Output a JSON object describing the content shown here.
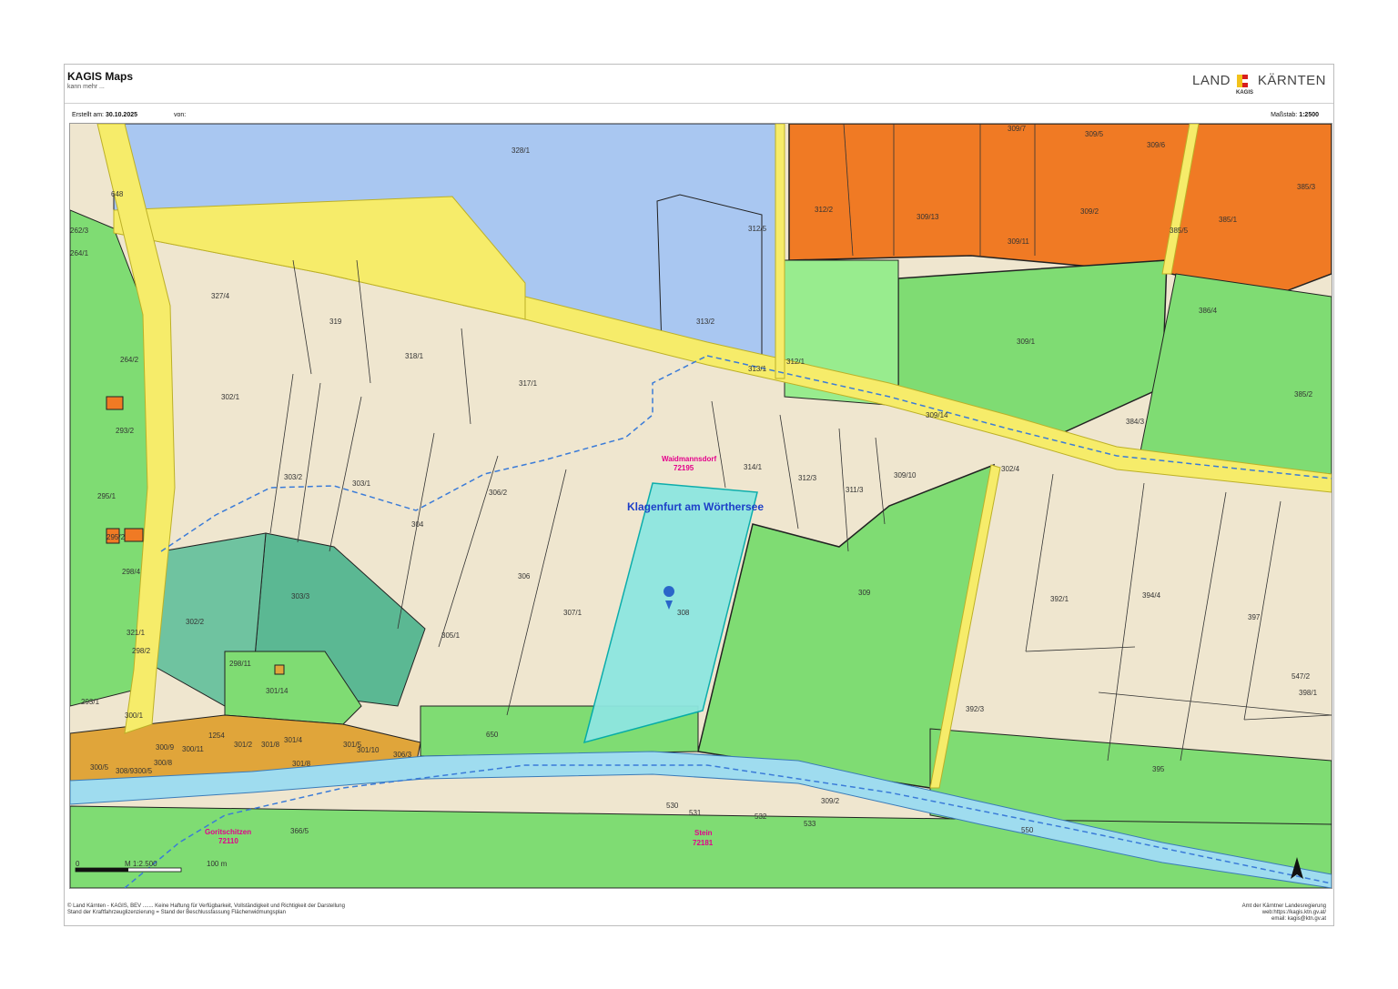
{
  "header": {
    "title": "KAGIS Maps",
    "subtitle": "kann mehr ...",
    "logo_left": "LAND",
    "logo_right": "KÄRNTEN",
    "logo_sub": "KAGIS"
  },
  "info": {
    "created_label": "Erstellt am:",
    "created_date": "30.10.2025",
    "from_label": "von:",
    "scale_label": "Maßstab:",
    "scale_value": "1:2500"
  },
  "map": {
    "place_name": "Klagenfurt am Wörthersee",
    "cadastral": [
      {
        "name": "Waidmannsdorf",
        "code": "72195"
      },
      {
        "name": "Goritschitzen",
        "code": "72110"
      },
      {
        "name": "Stein",
        "code": "72181"
      }
    ],
    "scalebar": {
      "left": "0",
      "middle": "M 1:2.500",
      "right": "100 m"
    },
    "colors": {
      "building_land": "#f07a24",
      "residential_dense": "#e0a53a",
      "green_land": "#7fdc73",
      "traffic": "#f6ec6a",
      "public": "#a9c7f1",
      "water": "#9fdcef",
      "arable": "#efe6cf",
      "selected": "#8ee6e0",
      "forest": "#5bb893"
    },
    "parcels": [
      "328/1",
      "648",
      "262/3",
      "264/1",
      "327/4",
      "319",
      "318/1",
      "317/1",
      "313/2",
      "313/1",
      "312/5",
      "312/2",
      "309/7",
      "309/5",
      "309/6",
      "309/13",
      "309/2",
      "309/11",
      "385/5",
      "385/1",
      "385/3",
      "386/4",
      "309/1",
      "312/1",
      "385/2",
      "384/3",
      "309/14",
      "264/2",
      "302/1",
      "293/2",
      "303/2",
      "303/1",
      "306/2",
      "314/1",
      "312/3",
      "311/3",
      "309/10",
      "302/4",
      "295/1",
      "304",
      "295/2",
      "298/4",
      "306",
      "307/1",
      "308",
      "309",
      "392/1",
      "394/4",
      "397",
      "302/2",
      "303/3",
      "305/1",
      "321/1",
      "298/2",
      "298/11",
      "301/14",
      "392/3",
      "547/2",
      "398/1",
      "293/1",
      "300/1",
      "650",
      "1254",
      "300/9",
      "300/11",
      "301/2",
      "301/8",
      "301/4",
      "301/8",
      "301/5",
      "301/10",
      "306/3",
      "395",
      "300/8",
      "300/5",
      "308/9",
      "300/5",
      "530",
      "531",
      "532",
      "533",
      "309/2",
      "550",
      "366/5"
    ]
  },
  "footer": {
    "left_line1": "© Land Kärnten - KAGIS, BEV ....... Keine Haftung für Verfügbarkeit, Vollständigkeit und Richtigkeit der Darstellung",
    "left_line2": "Stand der Kraftfahrzeuglizenzierung = Stand der Beschlussfassung Flächenwidmungsplan",
    "right_line1": "Amt der Kärntner Landesregierung",
    "right_line2": "web:https://kagis.ktn.gv.at/",
    "right_line3": "email: kagis@ktn.gv.at"
  }
}
